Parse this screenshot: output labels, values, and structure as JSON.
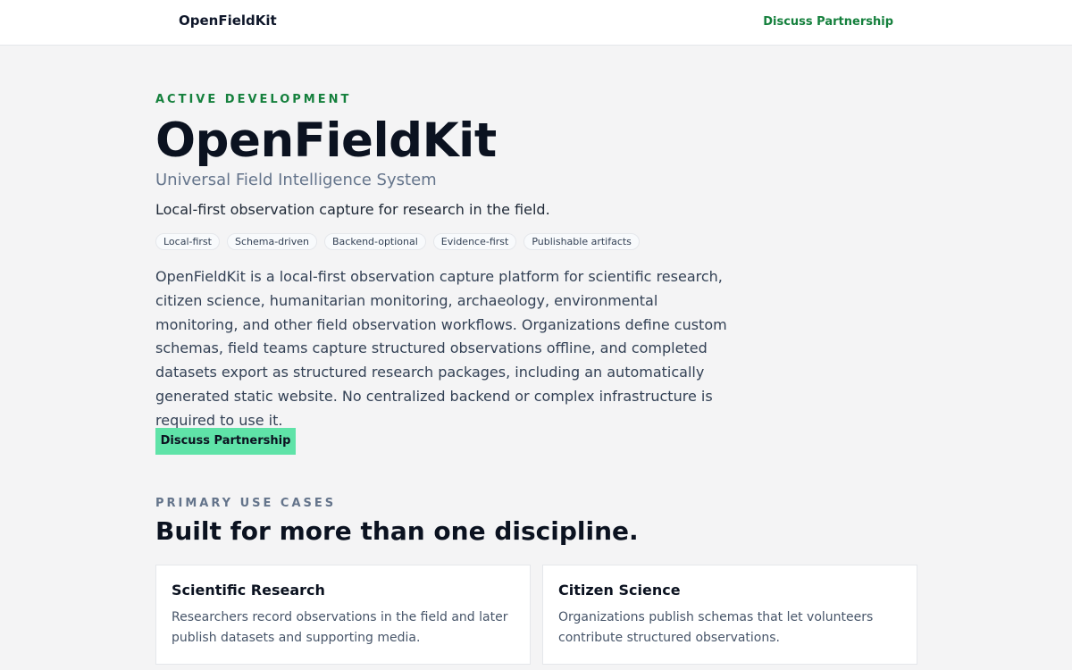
{
  "header": {
    "brand": "OpenFieldKit",
    "nav_cta": "Discuss Partnership"
  },
  "hero": {
    "eyebrow": "ACTIVE DEVELOPMENT",
    "title": "OpenFieldKit",
    "subtitle": "Universal Field Intelligence System",
    "tagline": "Local-first observation capture for research in the field.",
    "tags": [
      "Local-first",
      "Schema-driven",
      "Backend-optional",
      "Evidence-first",
      "Publishable artifacts"
    ],
    "description": "OpenFieldKit is a local-first observation capture platform for scientific research, citizen science, humanitarian monitoring, archaeology, environmental monitoring, and other field observation workflows. Organizations define custom schemas, field teams capture structured observations offline, and completed datasets export as structured research packages, including an automatically generated static website. No centralized backend or complex infrastructure is required to use it.",
    "cta_label": "Discuss Partnership"
  },
  "use_cases": {
    "eyebrow": "PRIMARY USE CASES",
    "title": "Built for more than one discipline.",
    "cards": [
      {
        "title": "Scientific Research",
        "body": "Researchers record observations in the field and later publish datasets and supporting media."
      },
      {
        "title": "Citizen Science",
        "body": "Organizations publish schemas that let volunteers contribute structured observations."
      }
    ]
  },
  "colors": {
    "accent": "#15803d",
    "cta_background": "#5fe3a8",
    "page_background": "#f4f4f5"
  }
}
